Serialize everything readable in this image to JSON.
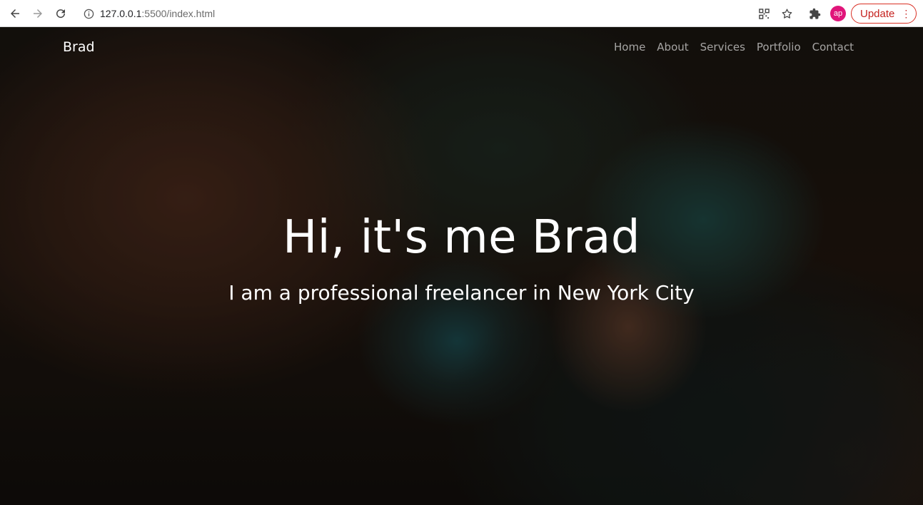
{
  "browser": {
    "url_host": "127.0.0.1",
    "url_rest": ":5500/index.html",
    "profile_initials": "ap",
    "update_label": "Update",
    "icons": [
      "back-icon",
      "forward-icon",
      "reload-icon",
      "info-icon",
      "qr-code-icon",
      "star-icon",
      "extensions-icon",
      "menu-dots-icon"
    ]
  },
  "site": {
    "brand": "Brad",
    "nav": [
      {
        "label": "Home"
      },
      {
        "label": "About"
      },
      {
        "label": "Services"
      },
      {
        "label": "Portfolio"
      },
      {
        "label": "Contact"
      }
    ],
    "hero": {
      "title": "Hi, it's me Brad",
      "subtitle": "I am a professional freelancer in New York City"
    }
  },
  "colors": {
    "update_accent": "#d93025",
    "avatar_bg": "#e0157a"
  }
}
